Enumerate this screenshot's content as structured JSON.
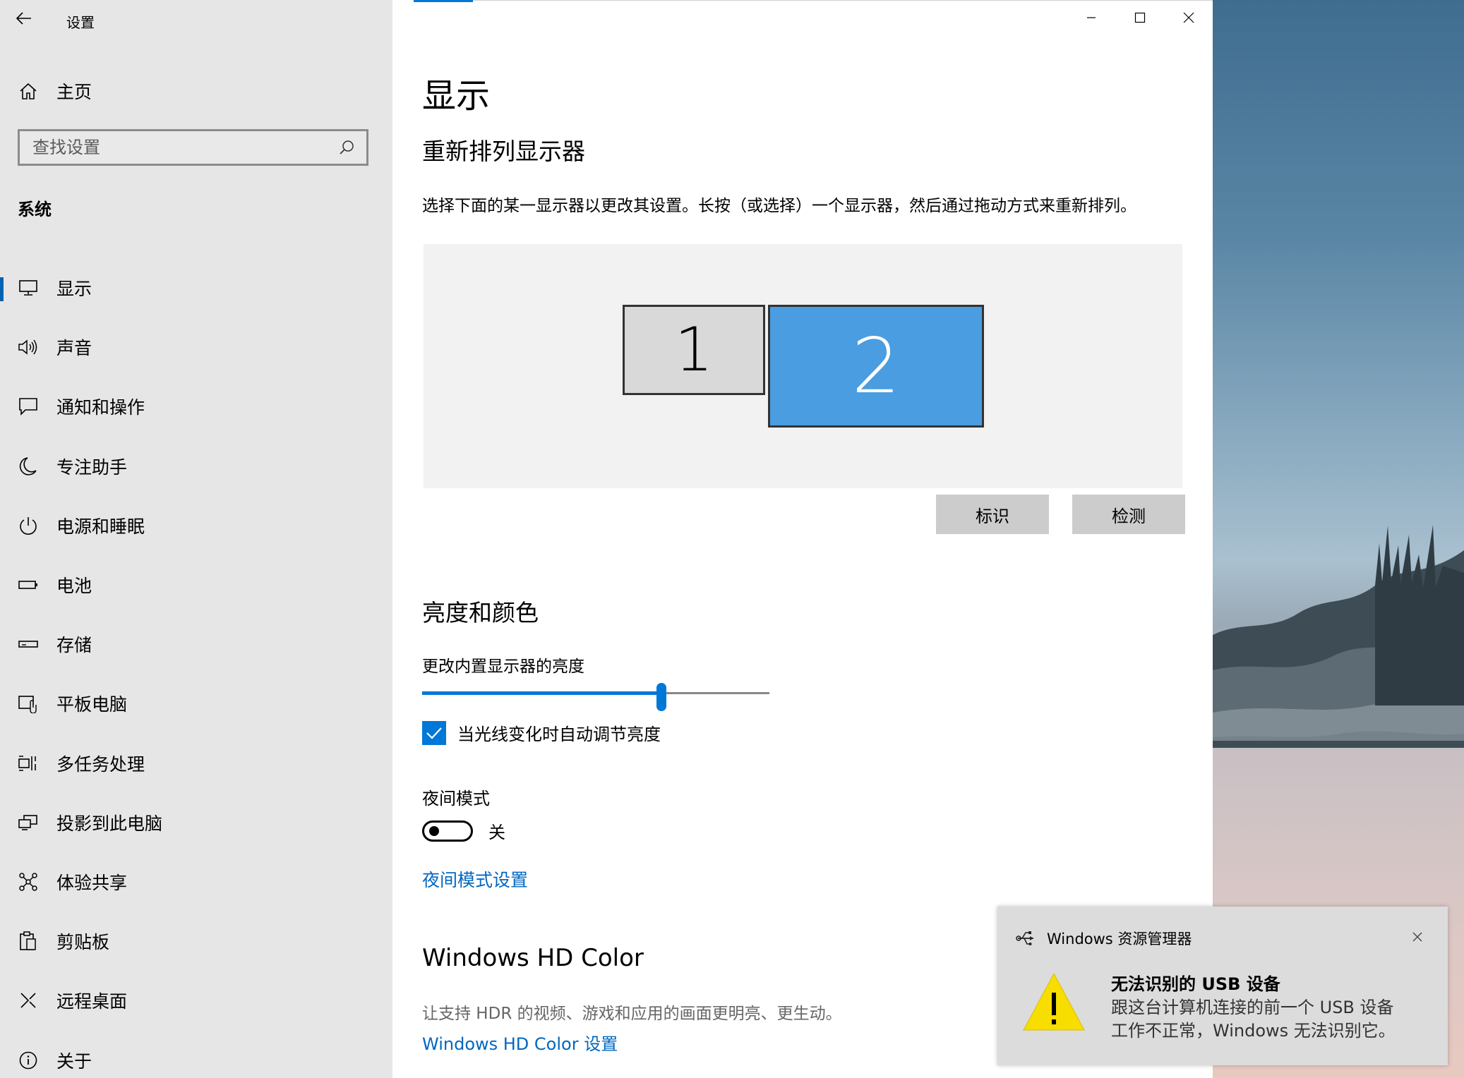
{
  "window": {
    "title": "设置",
    "controls": {
      "minimize_icon": "minimize-icon",
      "maximize_icon": "maximize-icon",
      "close_icon": "close-icon"
    }
  },
  "sidebar": {
    "home_label": "主页",
    "search_placeholder": "查找设置",
    "section_title": "系统",
    "items": [
      {
        "label": "显示",
        "icon": "monitor-icon",
        "active": true
      },
      {
        "label": "声音",
        "icon": "speaker-icon"
      },
      {
        "label": "通知和操作",
        "icon": "notification-icon"
      },
      {
        "label": "专注助手",
        "icon": "moon-icon"
      },
      {
        "label": "电源和睡眠",
        "icon": "power-icon"
      },
      {
        "label": "电池",
        "icon": "battery-icon"
      },
      {
        "label": "存储",
        "icon": "storage-icon"
      },
      {
        "label": "平板电脑",
        "icon": "tablet-icon"
      },
      {
        "label": "多任务处理",
        "icon": "multitasking-icon"
      },
      {
        "label": "投影到此电脑",
        "icon": "project-icon"
      },
      {
        "label": "体验共享",
        "icon": "shared-experiences-icon"
      },
      {
        "label": "剪贴板",
        "icon": "clipboard-icon"
      },
      {
        "label": "远程桌面",
        "icon": "remote-desktop-icon"
      },
      {
        "label": "关于",
        "icon": "info-icon"
      }
    ]
  },
  "main": {
    "page_title": "显示",
    "arrange_heading": "重新排列显示器",
    "arrange_instruction": "选择下面的某一显示器以更改其设置。长按（或选择）一个显示器，然后通过拖动方式来重新排列。",
    "monitors": [
      {
        "label": "1",
        "selected": false
      },
      {
        "label": "2",
        "selected": true
      }
    ],
    "identify_button": "标识",
    "detect_button": "检测",
    "brightness_heading": "亮度和颜色",
    "brightness_label": "更改内置显示器的亮度",
    "brightness_value": 0.69,
    "auto_brightness_label": "当光线变化时自动调节亮度",
    "auto_brightness_checked": true,
    "night_mode_label": "夜间模式",
    "night_mode_state": "关",
    "night_mode_link": "夜间模式设置",
    "hdr_heading": "Windows HD Color",
    "hdr_description": "让支持 HDR 的视频、游戏和应用的画面更明亮、更生动。",
    "hdr_link": "Windows HD Color 设置"
  },
  "notification": {
    "app_name": "Windows 资源管理器",
    "app_icon": "usb-icon",
    "title": "无法识别的 USB 设备",
    "line1": "跟这台计算机连接的前一个 USB 设备",
    "line2": "工作不正常，Windows 无法识别它。",
    "warning_icon": "warning-icon"
  },
  "colors": {
    "accent": "#0078d7",
    "link": "#0067c0",
    "sidebar_bg": "#e6e6e6",
    "selected_monitor": "#4a9de0",
    "unselected_monitor": "#d9d9d9",
    "warning_yellow": "#f7dd00"
  }
}
